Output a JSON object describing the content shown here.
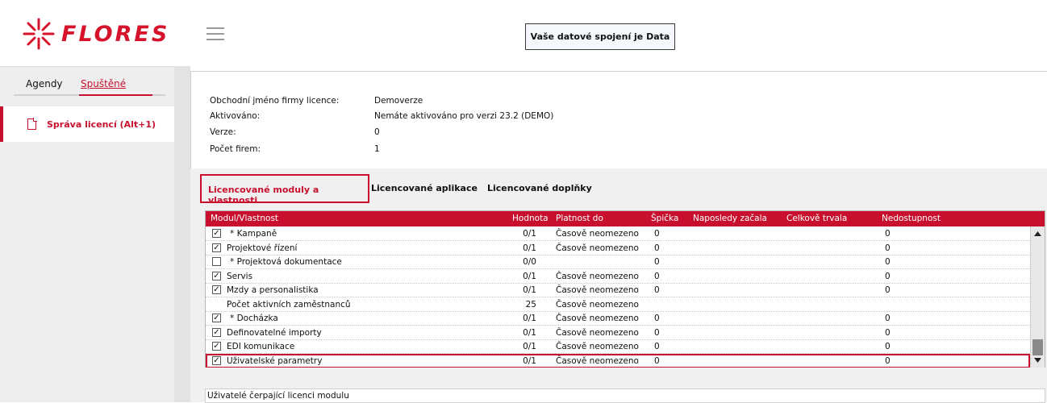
{
  "app": {
    "brand": "FLORES",
    "connection_text": "Vaše datové spojení je Data"
  },
  "sidebar": {
    "tabs": [
      {
        "label": "Agendy"
      },
      {
        "label": "Spuštěné"
      }
    ],
    "items": [
      {
        "label": "Správa licencí (Alt+1)"
      }
    ]
  },
  "info": {
    "rows": [
      {
        "key": "Obchodní jméno firmy licence:",
        "value": "Demoverze"
      },
      {
        "key": "Aktivováno:",
        "value": "Nemáte aktivováno pro verzi 23.2 (DEMO)"
      },
      {
        "key": "Verze:",
        "value": "0"
      },
      {
        "key": "Počet firem:",
        "value": "1"
      }
    ]
  },
  "tabs": [
    {
      "label": "Licencované moduly a vlastnosti"
    },
    {
      "label": "Licencované aplikace"
    },
    {
      "label": "Licencované doplňky"
    }
  ],
  "grid": {
    "columns": [
      "Modul/Vlastnost",
      "Hodnota",
      "Platnost do",
      "Špička",
      "Naposledy začala",
      "Celkově trvala",
      "Nedostupnost"
    ],
    "rows": [
      {
        "checked": true,
        "indent": true,
        "name": "* Kampaně",
        "value": "0/1",
        "validity": "Časově neomezeno",
        "peak": "0",
        "unavail": "0"
      },
      {
        "checked": true,
        "indent": false,
        "name": "Projektové řízení",
        "value": "0/1",
        "validity": "Časově neomezeno",
        "peak": "0",
        "unavail": "0"
      },
      {
        "checked": false,
        "indent": true,
        "name": "* Projektová dokumentace",
        "value": "0/0",
        "validity": "",
        "peak": "0",
        "unavail": "0"
      },
      {
        "checked": true,
        "indent": false,
        "name": "Servis",
        "value": "0/1",
        "validity": "Časově neomezeno",
        "peak": "0",
        "unavail": "0"
      },
      {
        "checked": true,
        "indent": false,
        "name": "Mzdy a personalistika",
        "value": "0/1",
        "validity": "Časově neomezeno",
        "peak": "0",
        "unavail": "0"
      },
      {
        "checked": null,
        "indent": false,
        "name": "Počet aktivních zaměstnanců",
        "value": "25",
        "validity": "Časově neomezeno",
        "peak": "",
        "unavail": ""
      },
      {
        "checked": true,
        "indent": true,
        "name": "* Docházka",
        "value": "0/1",
        "validity": "Časově neomezeno",
        "peak": "0",
        "unavail": "0"
      },
      {
        "checked": true,
        "indent": false,
        "name": "Definovatelné importy",
        "value": "0/1",
        "validity": "Časově neomezeno",
        "peak": "0",
        "unavail": "0"
      },
      {
        "checked": true,
        "indent": false,
        "name": "EDI komunikace",
        "value": "0/1",
        "validity": "Časově neomezeno",
        "peak": "0",
        "unavail": "0"
      },
      {
        "checked": true,
        "indent": false,
        "name": "Uživatelské parametry",
        "value": "0/1",
        "validity": "Časově neomezeno",
        "peak": "0",
        "unavail": "0"
      }
    ]
  },
  "footer": {
    "label": "Uživatelé čerpající licenci modulu"
  },
  "colors": {
    "accent": "#c8102e"
  }
}
